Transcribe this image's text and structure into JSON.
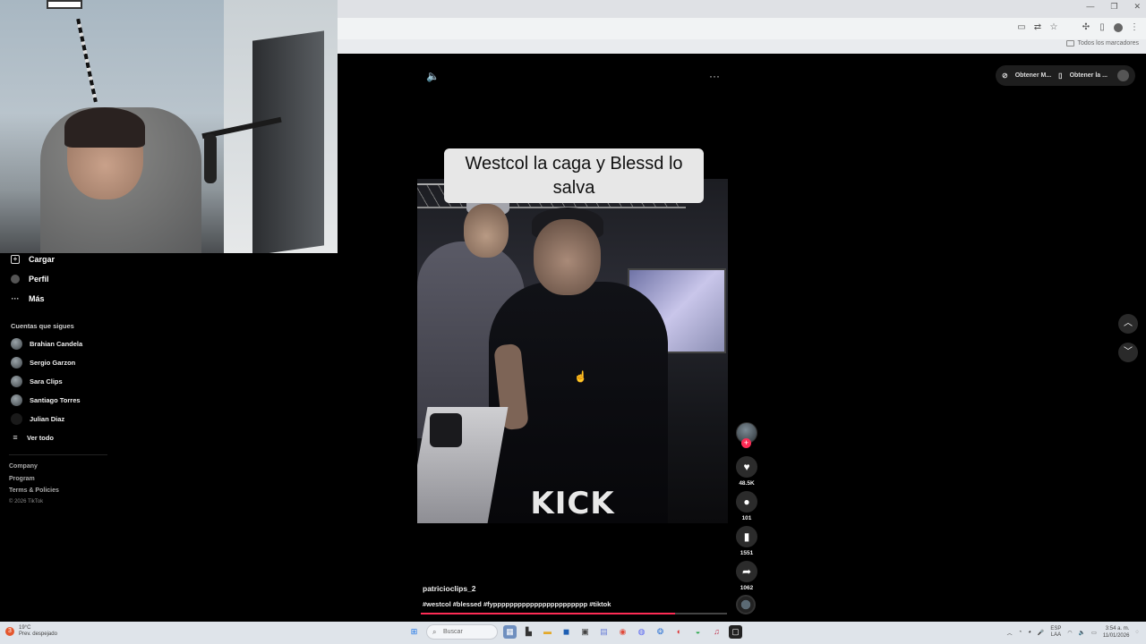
{
  "browser": {
    "bookmarks_label": "Todos los marcadores"
  },
  "sidebar": {
    "nav": [
      {
        "label": "Cargar",
        "icon": "upload-icon"
      },
      {
        "label": "Perfil",
        "icon": "profile-icon"
      },
      {
        "label": "Más",
        "icon": "more-icon"
      }
    ],
    "following_title": "Cuentas que sigues",
    "following": [
      {
        "name": "Brahian Candela"
      },
      {
        "name": "Sergio Garzon"
      },
      {
        "name": "Sara Clips"
      },
      {
        "name": "Santiago Torres"
      },
      {
        "name": "Julian Diaz"
      }
    ],
    "see_all": "Ver todo",
    "footer_links": [
      "Company",
      "Program",
      "Terms & Policies"
    ],
    "copyright": "© 2026 TikTok"
  },
  "video": {
    "caption_overlay": "Westcol la caga y Blessd lo salva",
    "watermark": "KICK",
    "author": "patricioclips_2",
    "hashtags": "#westcol #blessed #fyppppppppppppppppppppppp #tiktok",
    "progress": 0.83,
    "likes": "48.5K",
    "comments": "101",
    "saves": "1551",
    "shares": "1062"
  },
  "top_right": {
    "btn1": "Obtener M...",
    "btn2": "Obtener la ..."
  },
  "taskbar": {
    "weather_temp": "19°C",
    "weather_desc": "Prev. despejado",
    "search_placeholder": "Buscar",
    "lang_line1": "ESP",
    "lang_line2": "LAA",
    "time": "3:54 a. m.",
    "date": "11/01/2026"
  },
  "colors": {
    "accent": "#fe2c55",
    "background": "#000000",
    "caption_bg": "#e7e7e7"
  }
}
